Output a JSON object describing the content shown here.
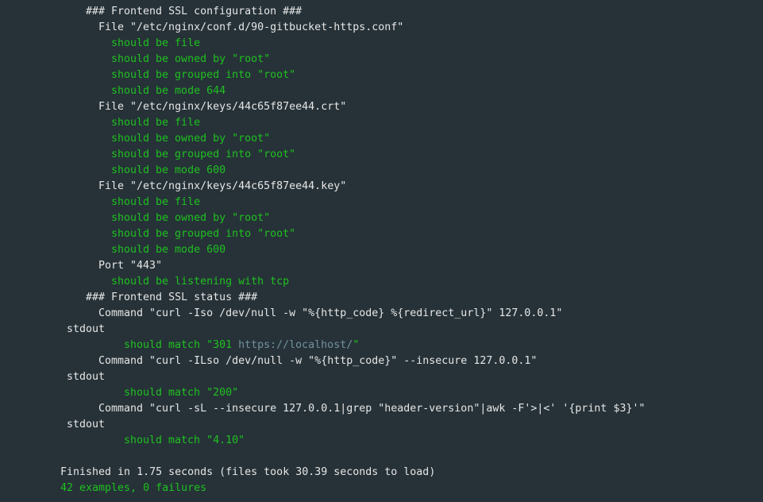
{
  "colors": {
    "background": "#263238",
    "text": "#e6e6e6",
    "pass": "#1fc11f",
    "link": "#72909e"
  },
  "lines": [
    {
      "indent": 4,
      "segments": [
        {
          "text": "### Frontend SSL configuration ###",
          "color": "white"
        }
      ]
    },
    {
      "indent": 6,
      "segments": [
        {
          "text": "File \"/etc/nginx/conf.d/90-gitbucket-https.conf\"",
          "color": "white"
        }
      ]
    },
    {
      "indent": 8,
      "segments": [
        {
          "text": "should be file",
          "color": "green"
        }
      ]
    },
    {
      "indent": 8,
      "segments": [
        {
          "text": "should be owned by \"root\"",
          "color": "green"
        }
      ]
    },
    {
      "indent": 8,
      "segments": [
        {
          "text": "should be grouped into \"root\"",
          "color": "green"
        }
      ]
    },
    {
      "indent": 8,
      "segments": [
        {
          "text": "should be mode 644",
          "color": "green"
        }
      ]
    },
    {
      "indent": 6,
      "segments": [
        {
          "text": "File \"/etc/nginx/keys/44c65f87ee44.crt\"",
          "color": "white"
        }
      ]
    },
    {
      "indent": 8,
      "segments": [
        {
          "text": "should be file",
          "color": "green"
        }
      ]
    },
    {
      "indent": 8,
      "segments": [
        {
          "text": "should be owned by \"root\"",
          "color": "green"
        }
      ]
    },
    {
      "indent": 8,
      "segments": [
        {
          "text": "should be grouped into \"root\"",
          "color": "green"
        }
      ]
    },
    {
      "indent": 8,
      "segments": [
        {
          "text": "should be mode 600",
          "color": "green"
        }
      ]
    },
    {
      "indent": 6,
      "segments": [
        {
          "text": "File \"/etc/nginx/keys/44c65f87ee44.key\"",
          "color": "white"
        }
      ]
    },
    {
      "indent": 8,
      "segments": [
        {
          "text": "should be file",
          "color": "green"
        }
      ]
    },
    {
      "indent": 8,
      "segments": [
        {
          "text": "should be owned by \"root\"",
          "color": "green"
        }
      ]
    },
    {
      "indent": 8,
      "segments": [
        {
          "text": "should be grouped into \"root\"",
          "color": "green"
        }
      ]
    },
    {
      "indent": 8,
      "segments": [
        {
          "text": "should be mode 600",
          "color": "green"
        }
      ]
    },
    {
      "indent": 6,
      "segments": [
        {
          "text": "Port \"443\"",
          "color": "white"
        }
      ]
    },
    {
      "indent": 8,
      "segments": [
        {
          "text": "should be listening with tcp",
          "color": "green"
        }
      ]
    },
    {
      "indent": 4,
      "segments": [
        {
          "text": "### Frontend SSL status ###",
          "color": "white"
        }
      ]
    },
    {
      "indent": 6,
      "segments": [
        {
          "text": "Command \"curl -Iso /dev/null -w \"%{http_code} %{redirect_url}\" 127.0.0.1\"",
          "color": "white"
        }
      ]
    },
    {
      "indent": 1,
      "segments": [
        {
          "text": "stdout",
          "color": "white"
        }
      ]
    },
    {
      "indent": 10,
      "segments": [
        {
          "text": "should match \"301 ",
          "color": "green"
        },
        {
          "text": "https://localhost/",
          "color": "link"
        },
        {
          "text": "\"",
          "color": "green"
        }
      ]
    },
    {
      "indent": 6,
      "segments": [
        {
          "text": "Command \"curl -ILso /dev/null -w \"%{http_code}\" --insecure 127.0.0.1\"",
          "color": "white"
        }
      ]
    },
    {
      "indent": 1,
      "segments": [
        {
          "text": "stdout",
          "color": "white"
        }
      ]
    },
    {
      "indent": 10,
      "segments": [
        {
          "text": "should match \"200\"",
          "color": "green"
        }
      ]
    },
    {
      "indent": 6,
      "segments": [
        {
          "text": "Command \"curl -sL --insecure 127.0.0.1|grep \"header-version\"|awk -F'>|<' '{print $3}'\"",
          "color": "white"
        }
      ]
    },
    {
      "indent": 1,
      "segments": [
        {
          "text": "stdout",
          "color": "white"
        }
      ]
    },
    {
      "indent": 10,
      "segments": [
        {
          "text": "should match \"4.10\"",
          "color": "green"
        }
      ]
    },
    {
      "indent": 0,
      "segments": []
    },
    {
      "indent": 0,
      "segments": [
        {
          "text": "Finished in 1.75 seconds (files took 30.39 seconds to load)",
          "color": "white"
        }
      ]
    },
    {
      "indent": 0,
      "segments": [
        {
          "text": "42 examples, 0 failures",
          "color": "green"
        }
      ]
    }
  ]
}
